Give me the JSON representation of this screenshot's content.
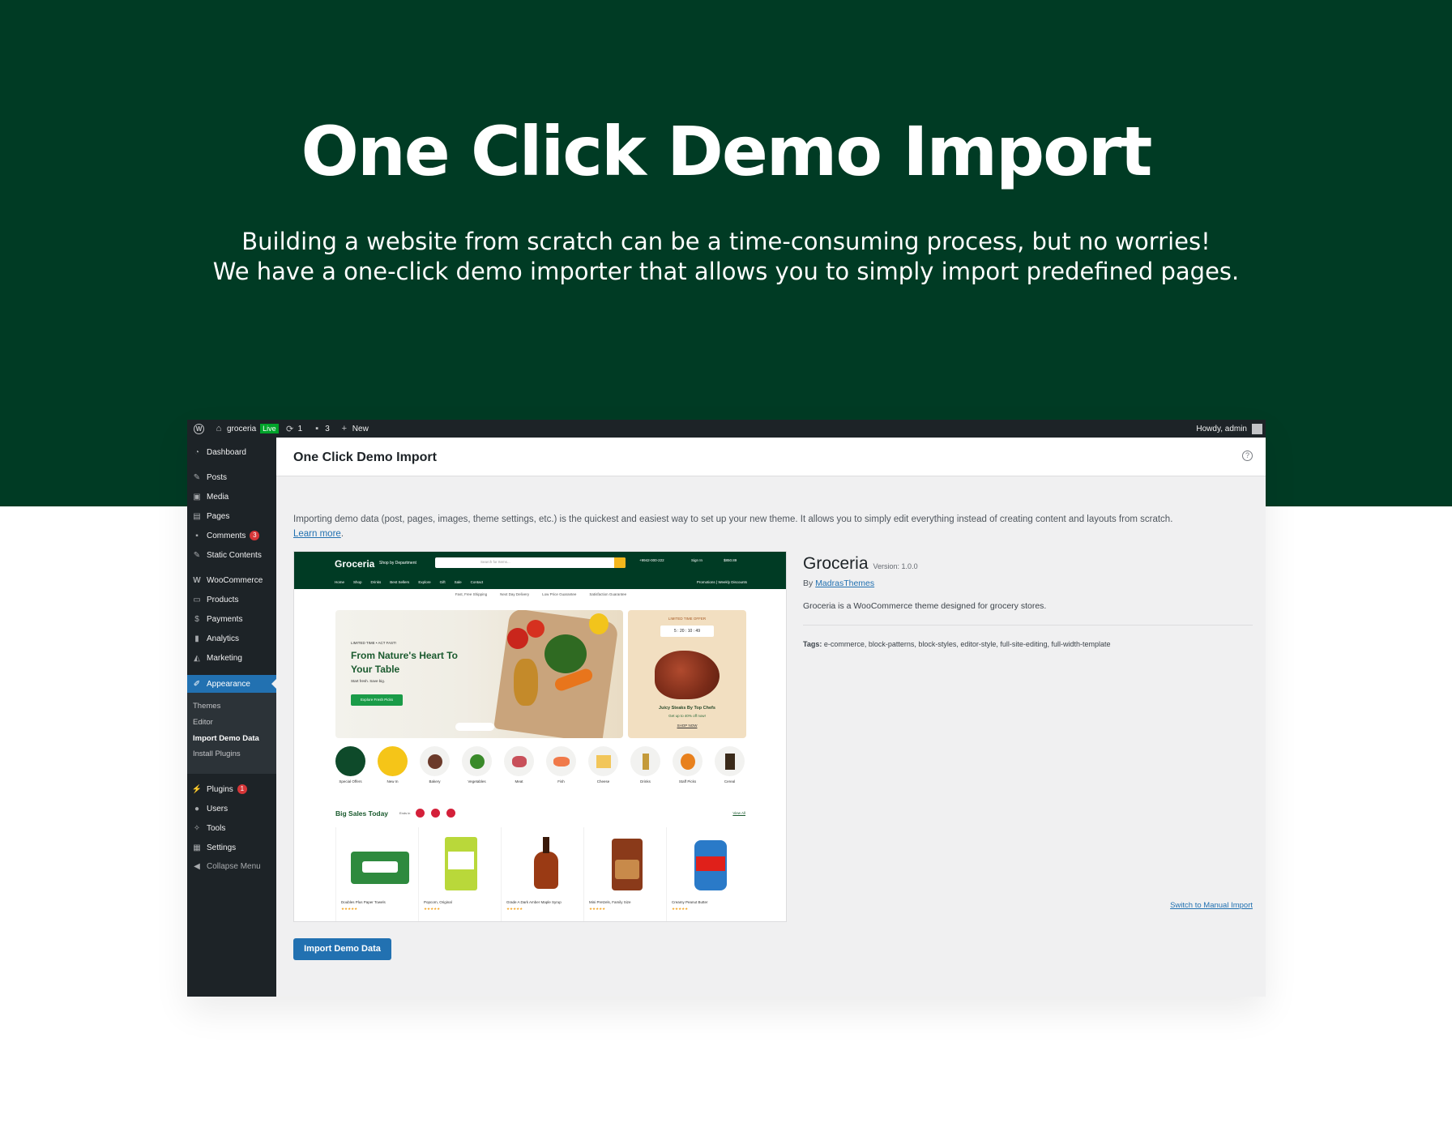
{
  "hero": {
    "title": "One Click Demo Import",
    "line1": "Building a website from scratch can be a time-consuming process, but no worries!",
    "line2": "We have a one-click demo importer that allows you to simply import predefined pages."
  },
  "adminbar": {
    "site_name": "groceria",
    "live_badge": "Live",
    "updates_count": "1",
    "comments_count": "3",
    "new_label": "New",
    "howdy": "Howdy, admin"
  },
  "sidebar": {
    "items": [
      {
        "label": "Dashboard",
        "icon": "dashboard-icon"
      },
      {
        "label": "Posts",
        "icon": "pin-icon"
      },
      {
        "label": "Media",
        "icon": "media-icon"
      },
      {
        "label": "Pages",
        "icon": "pages-icon"
      },
      {
        "label": "Comments",
        "icon": "comment-icon",
        "badge": "3"
      },
      {
        "label": "Static Contents",
        "icon": "pin-icon"
      },
      {
        "label": "WooCommerce",
        "icon": "woo-icon"
      },
      {
        "label": "Products",
        "icon": "archive-icon"
      },
      {
        "label": "Payments",
        "icon": "dollar-icon"
      },
      {
        "label": "Analytics",
        "icon": "chart-icon"
      },
      {
        "label": "Marketing",
        "icon": "megaphone-icon"
      },
      {
        "label": "Appearance",
        "icon": "brush-icon"
      },
      {
        "label": "Plugins",
        "icon": "plug-icon",
        "badge": "1"
      },
      {
        "label": "Users",
        "icon": "user-icon"
      },
      {
        "label": "Tools",
        "icon": "wrench-icon"
      },
      {
        "label": "Settings",
        "icon": "settings-icon"
      },
      {
        "label": "Collapse Menu",
        "icon": "collapse-icon"
      }
    ],
    "submenu": [
      "Themes",
      "Editor",
      "Import Demo Data",
      "Install Plugins"
    ]
  },
  "main": {
    "title": "One Click Demo Import",
    "intro": "Importing demo data (post, pages, images, theme settings, etc.) is the quickest and easiest way to set up your new theme. It allows you to simply edit everything instead of creating content and layouts from scratch.",
    "learn_more": "Learn more",
    "theme_name": "Groceria",
    "theme_version": "Version: 1.0.0",
    "by_label": "By",
    "author": "MadrasThemes",
    "description": "Groceria is a WooCommerce theme designed for grocery stores.",
    "tags_label": "Tags:",
    "tags": "e-commerce, block-patterns, block-styles, editor-style, full-site-editing, full-width-template",
    "manual_link": "Switch to Manual Import",
    "import_button": "Import Demo Data"
  },
  "preview": {
    "logo": "Groceria",
    "shop_by": "Shop by Department",
    "search_placeholder": "Search for Items...",
    "hotline": "+9942-000-222",
    "account": "Sign In",
    "cart": "$850.89",
    "nav": [
      "Home",
      "Shop",
      "Drinks",
      "Best Sellers",
      "Explore",
      "Gift",
      "Sale",
      "Contact"
    ],
    "promos": "Promotions  |  Weekly Discounts",
    "usps": [
      "Fast, Free Shipping",
      "Next Day Delivery",
      "Low Price Guarantee",
      "Satisfaction Guarantee"
    ],
    "hero_kicker": "LIMITED TIME • ACT FAST!",
    "hero_title": "From Nature's Heart To Your Table",
    "hero_sub": "Start fresh. Save big.",
    "hero_btn": "Explore Fresh Picks",
    "offer_kicker": "LIMITED TIME OFFER",
    "offer_timer": "5 : 20 : 10 : 49",
    "offer_title": "Juicy Steaks By Top Chefs",
    "offer_sub": "Get up to 40% off now!",
    "offer_link": "SHOP NOW",
    "categories": [
      "Special Offers",
      "New In",
      "Bakery",
      "Vegetables",
      "Meat",
      "Fish",
      "Cheese",
      "Drinks",
      "Staff Picks",
      "Cereal"
    ],
    "sales_title": "Big Sales Today",
    "ends_in": "Ends in",
    "view_all": "View All",
    "products": [
      "Doubles Plus Paper Towels",
      "Popcorn, Original",
      "Grade A Dark Amber Maple Syrup",
      "Mini Pretzels, Family Size",
      "Creamy Peanut Butter"
    ],
    "stars": "★★★★★"
  },
  "colors": {
    "hero_bg": "#003b24",
    "wp_blue": "#2271b1",
    "admin_dark": "#1d2327"
  }
}
